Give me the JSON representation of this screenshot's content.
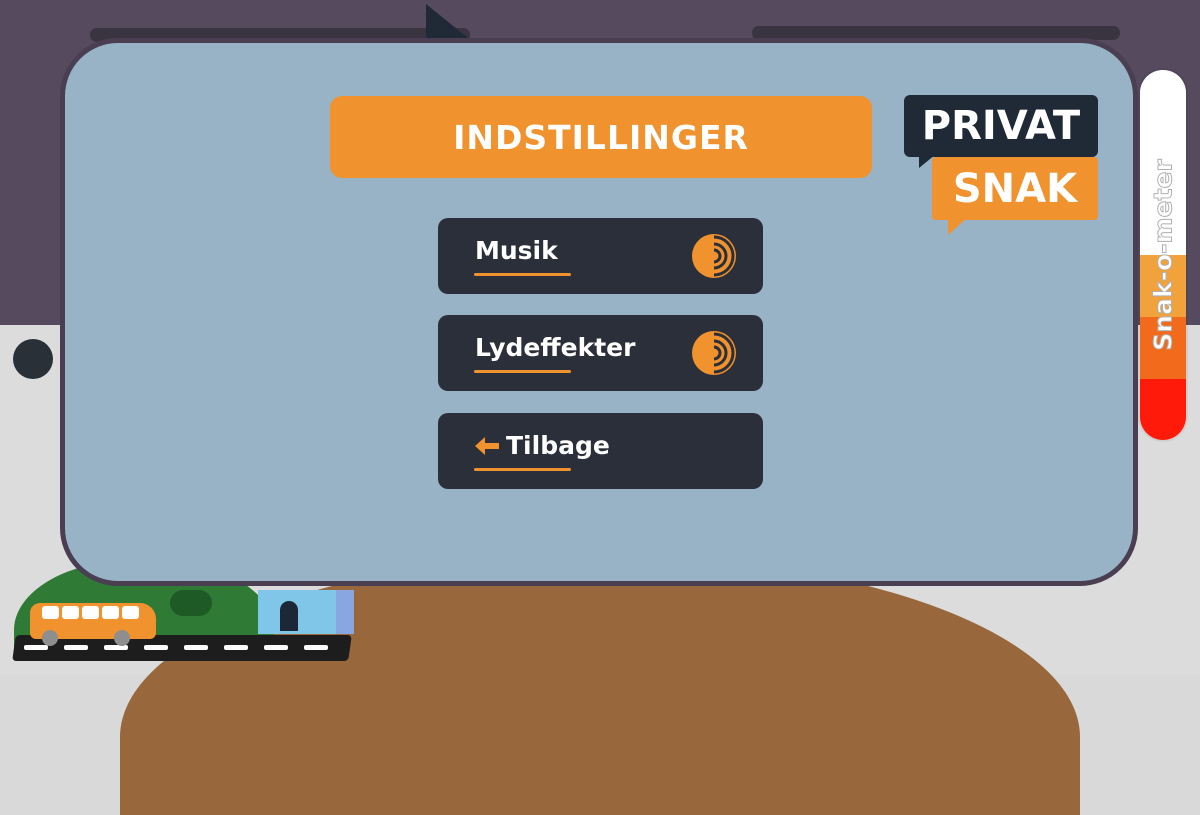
{
  "screen": {
    "title": "INDSTILLINGER",
    "menu": [
      {
        "label": "Musik",
        "icon": "sound-on-icon"
      },
      {
        "label": "Lydeffekter",
        "icon": "sound-on-icon"
      },
      {
        "label": "Tilbage",
        "icon": "back-arrow-icon"
      }
    ]
  },
  "logo": {
    "line1": "PRIVAT",
    "line2": "SNAK"
  },
  "meter": {
    "label": "Snak-o-meter",
    "level": 0.33
  },
  "colors": {
    "accent": "#f0922d",
    "button": "#2b2f3a",
    "panel": "#98b3c6",
    "dark": "#1f2a36"
  }
}
